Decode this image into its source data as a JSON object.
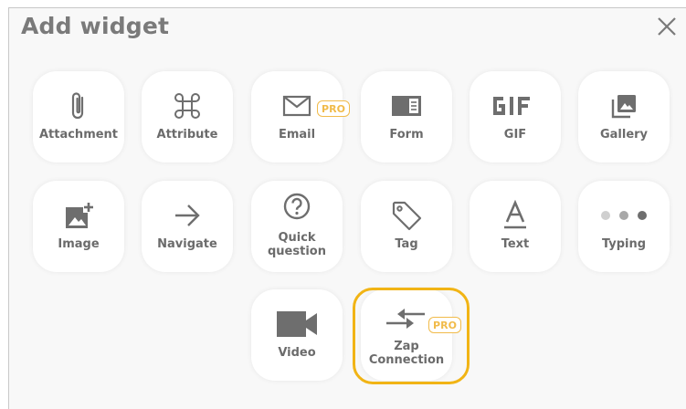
{
  "dialog": {
    "title": "Add widget",
    "close_icon": "close-icon"
  },
  "badge": {
    "pro_label": "PRO"
  },
  "widgets": [
    {
      "label": "Attachment",
      "icon": "paperclip-icon"
    },
    {
      "label": "Attribute",
      "icon": "command-icon"
    },
    {
      "label": "Email",
      "icon": "envelope-icon",
      "pro": true
    },
    {
      "label": "Form",
      "icon": "form-icon"
    },
    {
      "label": "GIF",
      "icon": "gif-icon"
    },
    {
      "label": "Gallery",
      "icon": "gallery-icon"
    },
    {
      "label": "Image",
      "icon": "add-image-icon"
    },
    {
      "label": "Navigate",
      "icon": "arrow-right-icon"
    },
    {
      "label": "Quick question",
      "icon": "question-circle-icon"
    },
    {
      "label": "Tag",
      "icon": "tag-icon"
    },
    {
      "label": "Text",
      "icon": "text-format-icon"
    },
    {
      "label": "Typing",
      "icon": "typing-dots-icon"
    },
    {
      "label": "Video",
      "icon": "video-camera-icon"
    },
    {
      "label": "Zap Connection",
      "icon": "swap-arrows-icon",
      "pro": true,
      "highlighted": true
    }
  ],
  "colors": {
    "icon": "#6e6e6e",
    "pro_badge": "#f1bb4a",
    "highlight": "#f1b415"
  }
}
